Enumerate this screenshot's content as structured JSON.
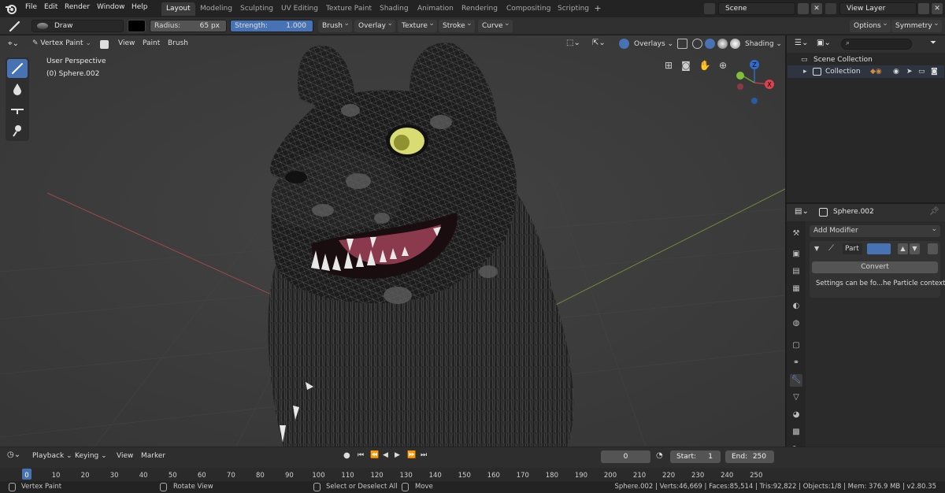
{
  "topbar": {
    "menus": [
      "File",
      "Edit",
      "Render",
      "Window",
      "Help"
    ],
    "workspaces": [
      "Layout",
      "Modeling",
      "Sculpting",
      "UV Editing",
      "Texture Paint",
      "Shading",
      "Animation",
      "Rendering",
      "Compositing",
      "Scripting"
    ],
    "active_workspace": "Layout",
    "scene": "Scene",
    "view_layer": "View Layer"
  },
  "tool_header": {
    "brush_name": "Draw",
    "radius_label": "Radius:",
    "radius_value": "65 px",
    "strength_label": "Strength:",
    "strength_value": "1.000",
    "strength_fill": 1.0,
    "dropdowns": [
      "Brush",
      "Overlay",
      "Texture",
      "Stroke",
      "Curve"
    ],
    "options": "Options",
    "symmetry": "Symmetry"
  },
  "viewport": {
    "mode": "Vertex Paint",
    "menus": [
      "View",
      "Paint",
      "Brush"
    ],
    "perspective": "User Perspective",
    "object": "(0) Sphere.002",
    "overlays": "Overlays",
    "shading": "Shading",
    "gizmo": {
      "z": "Z",
      "x": "X"
    }
  },
  "outliner": {
    "search_placeholder": "",
    "scene_collection": "Scene Collection",
    "collection": "Collection"
  },
  "properties": {
    "object_name": "Sphere.002",
    "add_modifier": "Add Modifier",
    "modifier_name": "Part",
    "convert_button": "Convert",
    "info_text": "Settings can be fo...he Particle context"
  },
  "timeline": {
    "menus": [
      "Playback",
      "Keying",
      "View",
      "Marker"
    ],
    "current_frame": "0",
    "start_label": "Start:",
    "start_value": "1",
    "end_label": "End:",
    "end_value": "250",
    "ruler": [
      "0",
      "10",
      "20",
      "30",
      "40",
      "50",
      "60",
      "70",
      "80",
      "90",
      "100",
      "110",
      "120",
      "130",
      "140",
      "150",
      "160",
      "170",
      "180",
      "190",
      "200",
      "210",
      "220",
      "230",
      "240",
      "250"
    ]
  },
  "statusbar": {
    "left": "Vertex Paint",
    "middle": "Rotate View",
    "select": "Select or Deselect All",
    "move": "Move",
    "stats": "Sphere.002 | Verts:46,669 | Faces:85,514 | Tris:92,822 | Objects:1/8 | Mem: 376.9 MB | v2.80.35"
  },
  "colors": {
    "accent": "#4772b3",
    "header": "#303030",
    "viewport_bg": "#3d3d3d"
  }
}
